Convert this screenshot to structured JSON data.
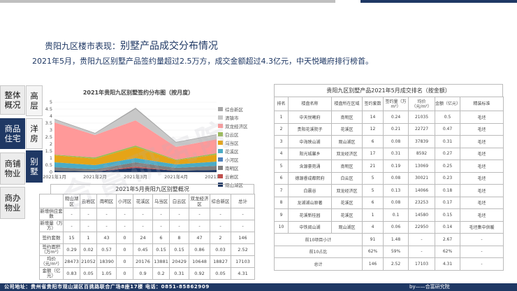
{
  "header": {
    "subtitle_prefix": "贵阳九区楼市表现：",
    "subtitle_main": "别墅产品成交分布情况",
    "summary": "2021年5月，贵阳九区别墅产品签约量超过2.5万方，成交金额超过4.3亿元，中天悦曦府排行榜首。"
  },
  "nav": {
    "main_items": [
      {
        "label": "整体\n概况",
        "active": false
      },
      {
        "label": "商品\n住宅",
        "active": true
      },
      {
        "label": "商铺\n物业",
        "active": false
      },
      {
        "label": "商办\n物业",
        "active": false
      }
    ],
    "sub_items": [
      {
        "label": "高\n层",
        "active": false
      },
      {
        "label": "洋\n房",
        "active": false
      },
      {
        "label": "别\n墅",
        "active": true
      }
    ]
  },
  "watermark": "合富研究院",
  "chart_data": {
    "type": "area",
    "title": "2021年贵阳九区别墅签约分布图（按月度）",
    "categories": [
      "2021年1月",
      "2021年2月",
      "2021年3月",
      "2021年4月",
      "2021年5月"
    ],
    "ylim": [
      0,
      5
    ],
    "yticks": [
      0,
      0.5,
      1,
      1.5,
      2,
      2.5,
      3,
      3.5,
      4,
      4.5,
      5
    ],
    "series": [
      {
        "name": "观山湖区",
        "color": "#1f3864",
        "values": [
          0.1,
          0.05,
          0.3,
          0.1,
          0.15
        ]
      },
      {
        "name": "云岩区",
        "color": "#c0504d",
        "values": [
          0.0,
          0.0,
          0.1,
          0.0,
          0.0
        ]
      },
      {
        "name": "南明区",
        "color": "#7f7f7f",
        "values": [
          0.25,
          0.15,
          0.3,
          0.2,
          0.3
        ]
      },
      {
        "name": "小河区",
        "color": "#4f81bd",
        "values": [
          0.0,
          0.0,
          0.0,
          0.0,
          0.0
        ]
      },
      {
        "name": "花溪区",
        "color": "#4bacc6",
        "values": [
          0.35,
          0.3,
          0.3,
          0.25,
          0.3
        ]
      },
      {
        "name": "乌当区",
        "color": "#e5a417",
        "values": [
          0.5,
          0.45,
          0.8,
          0.3,
          0.5
        ]
      },
      {
        "name": "白云区",
        "color": "#9bbb59",
        "values": [
          0.05,
          0.1,
          0.1,
          0.05,
          0.1
        ]
      },
      {
        "name": "双龙经济区",
        "color": "#ff9999",
        "values": [
          2.3,
          1.6,
          1.8,
          0.9,
          1.0
        ]
      },
      {
        "name": "清镇市",
        "color": "#c8c8c8",
        "values": [
          0.2,
          0.1,
          0.8,
          0.3,
          0.3
        ]
      },
      {
        "name": "综合新区",
        "color": "#a6a6a6",
        "values": [
          0.05,
          0.05,
          0.1,
          0.05,
          0.05
        ]
      }
    ]
  },
  "overview_table": {
    "title": "2021年5月贵阳九区别墅概况",
    "headers": [
      "",
      "观山湖区",
      "云岩区",
      "南明区",
      "小河区",
      "花溪区",
      "乌当区",
      "白云区",
      "双龙经济区",
      "综合新区",
      "总计"
    ],
    "rows": [
      {
        "label": "新增供应套数",
        "values": [
          "-",
          "-",
          "-",
          "-",
          "-",
          "-",
          "-",
          "-",
          "-",
          "-"
        ]
      },
      {
        "label": "新增量（万方）",
        "values": [
          "-",
          "-",
          "-",
          "-",
          "-",
          "-",
          "-",
          "-",
          "-",
          "-"
        ]
      },
      {
        "label": "签约套数",
        "values": [
          "15",
          "1",
          "43",
          "0",
          "24",
          "6",
          "8",
          "47",
          "2",
          "146"
        ]
      },
      {
        "label": "签约面积（万m²）",
        "values": [
          "0.29",
          "0.02",
          "0.57",
          "0",
          "0.45",
          "0.15",
          "0.15",
          "0.86",
          "0.03",
          "2.52"
        ]
      },
      {
        "label": "均价（元/m²）",
        "values": [
          "28473",
          "21052",
          "18390",
          "0",
          "20176",
          "13881",
          "20429",
          "10648",
          "18827",
          "17103"
        ]
      },
      {
        "label": "金额（亿元）",
        "values": [
          "0.83",
          "0.05",
          "1.05",
          "0",
          "0.9",
          "0.2",
          "0.31",
          "0.92",
          "0.05",
          "4.31"
        ]
      }
    ]
  },
  "ranking_table": {
    "title": "贵阳九区别墅产品2021年5月成交排名（按金额）",
    "headers": [
      "排名",
      "楼盘名称",
      "楼盘所在区域",
      "签约套数",
      "签约量（万m²）",
      "均价（元/m²）",
      "金额（亿元）",
      "精装标准"
    ],
    "rows": [
      [
        "1",
        "中天悦曦府",
        "南明区",
        "14",
        "0.24",
        "21035",
        "0.5",
        "毛坯"
      ],
      [
        "2",
        "贵阳花溪院子",
        "花溪区",
        "12",
        "0.21",
        "22727",
        "0.47",
        "毛坯"
      ],
      [
        "3",
        "中海映山湖",
        "观山湖区",
        "6",
        "0.08",
        "37839",
        "0.31",
        "毛坯"
      ],
      [
        "4",
        "阳光城馨乡",
        "双龙经济区",
        "17",
        "0.31",
        "8592",
        "0.27",
        "毛坯"
      ],
      [
        "5",
        "含源豪苑涌",
        "南明区",
        "21",
        "0.19",
        "13069",
        "0.25",
        "毛坯"
      ],
      [
        "6",
        "德源睿成都熙府",
        "白云区",
        "5",
        "0.08",
        "30021",
        "0.23",
        "毛坯"
      ],
      [
        "7",
        "白晨谷",
        "双龙经济区",
        "5",
        "0.13",
        "14066",
        "0.18",
        "毛坯"
      ],
      [
        "8",
        "龙湖湖山原著",
        "花溪区",
        "6",
        "0.08",
        "23253",
        "0.17",
        "毛坯"
      ],
      [
        "9",
        "花溪新桂园",
        "花溪区",
        "1",
        "0.1",
        "14580",
        "0.15",
        "毛坯"
      ],
      [
        "10",
        "中铁阅山湖",
        "观山湖区",
        "4",
        "0.06",
        "22950",
        "0.14",
        "毛坯集中供暖"
      ]
    ],
    "summary_rows": [
      {
        "label": "前10项目小计",
        "values": [
          "91",
          "1.48",
          "-",
          "2.67",
          "-"
        ]
      },
      {
        "label": "前10占比",
        "values": [
          "62%",
          "59%",
          "-",
          "62%",
          "-"
        ]
      },
      {
        "label": "总计",
        "values": [
          "146",
          "2.52",
          "17103",
          "4.31",
          "-"
        ]
      }
    ]
  },
  "footer": {
    "address": "公司地址：贵州省贵阳市观山湖区百挑路联合广场8座17楼   电话：0851-85862909",
    "brand": "by——合富研究院"
  }
}
